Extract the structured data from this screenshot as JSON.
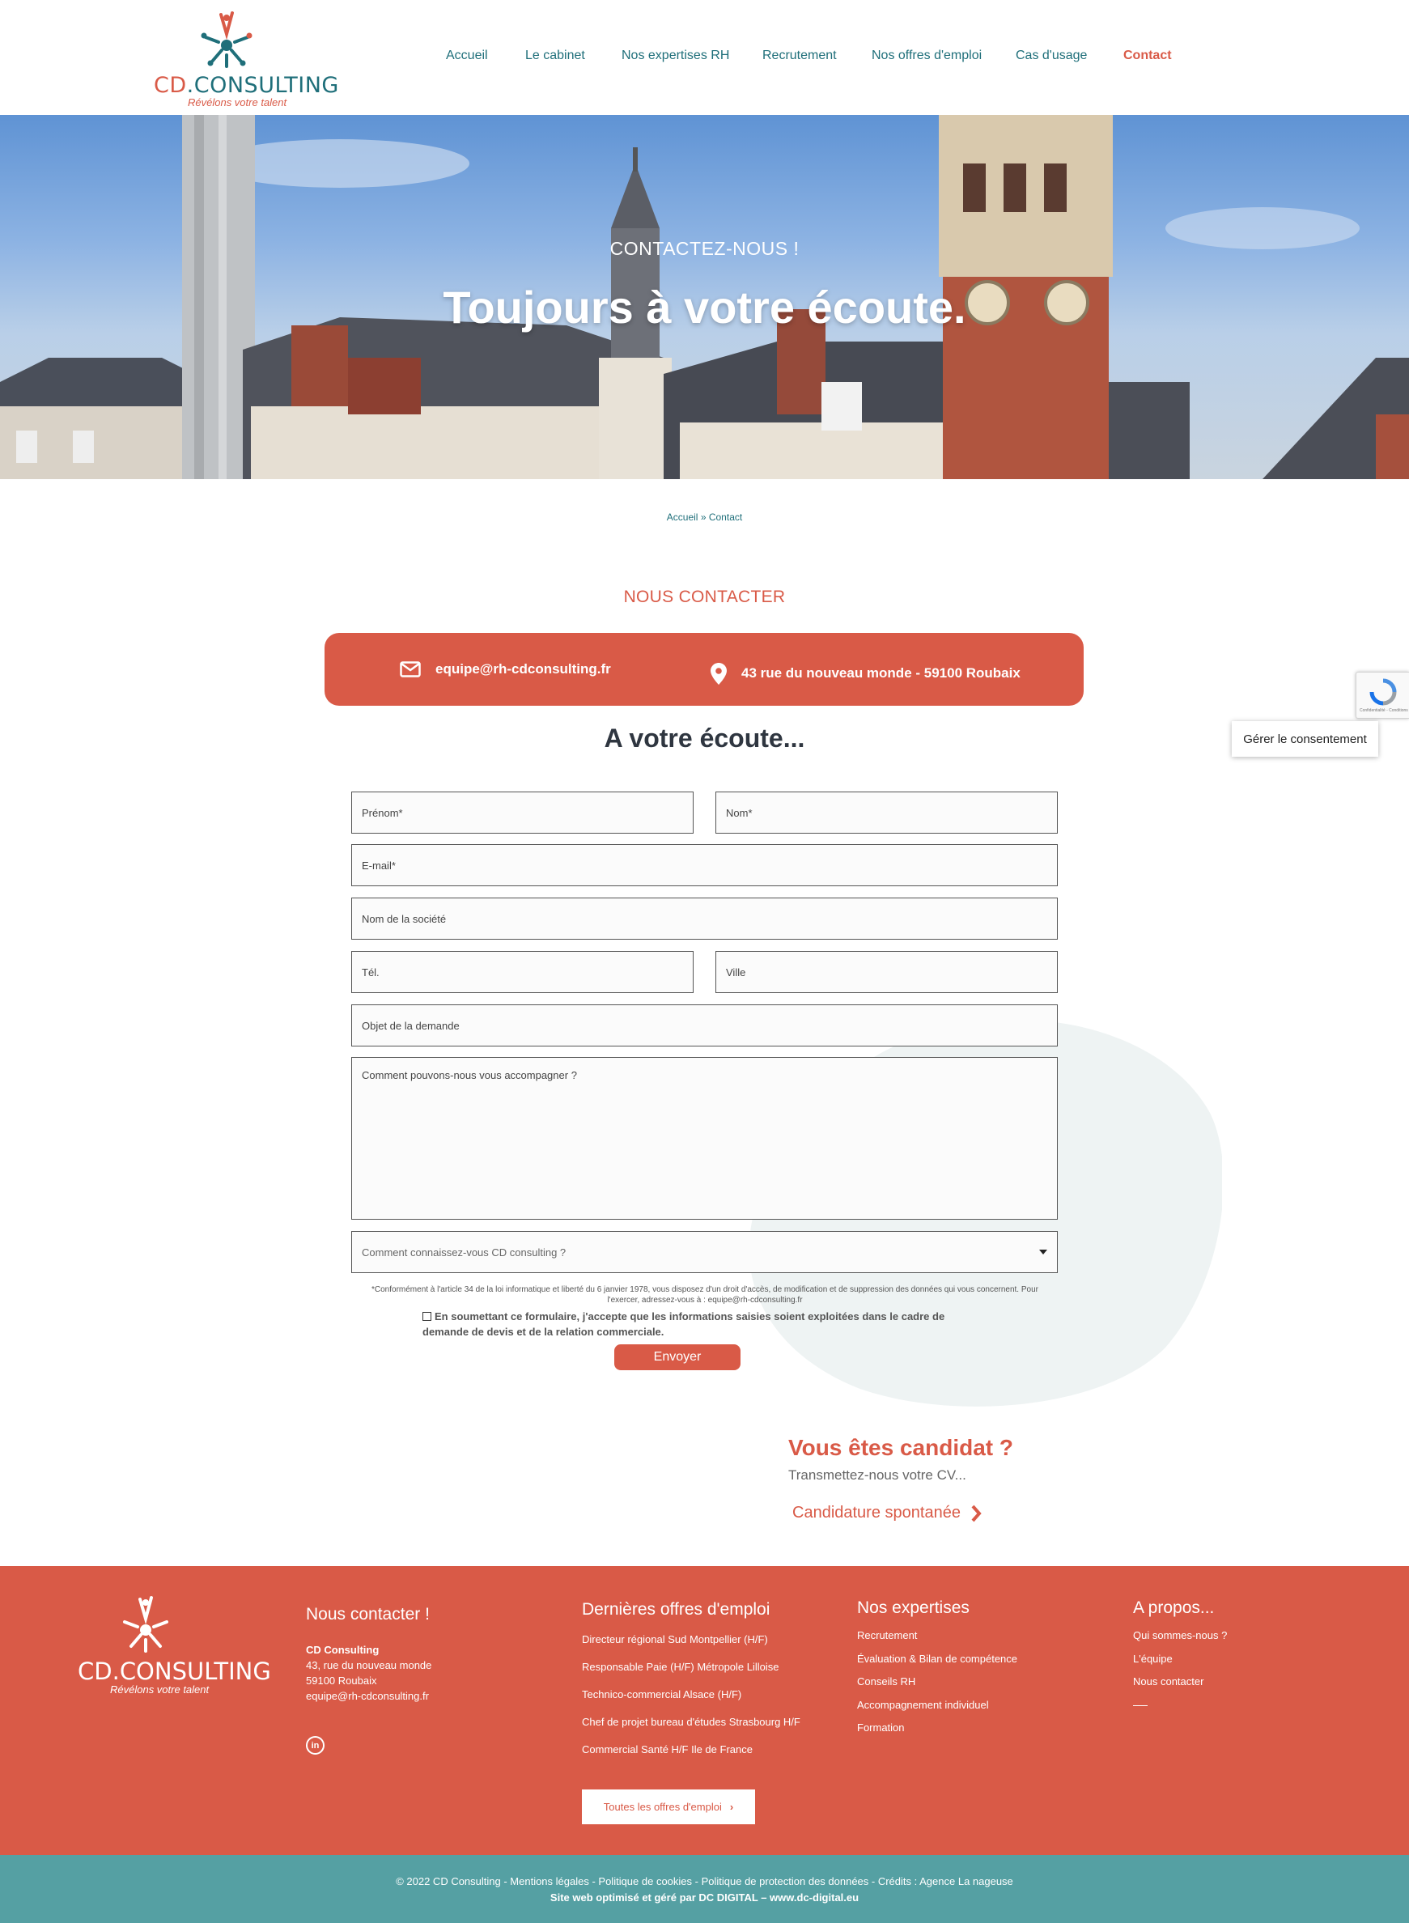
{
  "brand": {
    "logo_main": "CONSULTING",
    "logo_prefix": "CD",
    "logo_tagline": "Révélons votre talent",
    "accent_color": "#d95a47",
    "teal_color": "#1f6f7a"
  },
  "nav": {
    "items": [
      {
        "label": "Accueil"
      },
      {
        "label": "Le cabinet"
      },
      {
        "label": "Nos expertises RH"
      },
      {
        "label": "Recrutement"
      },
      {
        "label": "Nos offres d'emploi"
      },
      {
        "label": "Cas d'usage"
      },
      {
        "label": "Contact"
      }
    ],
    "active": "Contact"
  },
  "hero": {
    "kicker": "CONTACTEZ-NOUS !",
    "title": "Toujours à votre écoute."
  },
  "breadcrumb": {
    "home": "Accueil",
    "separator": "»",
    "current": "Contact"
  },
  "contact": {
    "section_title": "NOUS CONTACTER",
    "email": "equipe@rh-cdconsulting.fr",
    "address": "43 rue du nouveau monde - 59100 Roubaix"
  },
  "form": {
    "title": "A votre écoute...",
    "first_name": "Prénom*",
    "last_name": "Nom*",
    "email": "E-mail*",
    "company": "Nom de la société",
    "phone": "Tél.",
    "city": "Ville",
    "subject": "Objet de la demande",
    "message": "Comment pouvons-nous vous accompagner ?",
    "source_select": "Comment connaissez-vous CD consulting ?",
    "legal_line1": "*Conformément à l'article 34 de la loi informatique et liberté du 6 janvier 1978, vous disposez d'un droit d'accès, de modification et de suppression des données qui vous concernent. Pour",
    "legal_line2": "l'exercer, adressez-vous à : equipe@rh-cdconsulting.fr",
    "consent_text": "En soumettant ce formulaire, j'accepte que les informations saisies soient exploitées dans le cadre de demande de devis et de la relation commerciale.",
    "submit": "Envoyer"
  },
  "widgets": {
    "recaptcha_text": "Confidentialité - Conditions",
    "consent_manager": "Gérer le consentement"
  },
  "candidate": {
    "title": "Vous êtes candidat ?",
    "subtitle": "Transmettez-nous votre CV...",
    "link": "Candidature spontanée"
  },
  "footer": {
    "contact": {
      "heading": "Nous contacter !",
      "company": "CD Consulting",
      "street": "43, rue du nouveau monde",
      "city": "59100 Roubaix",
      "email": "equipe@rh-cdconsulting.fr"
    },
    "offers": {
      "heading": "Dernières offres d'emploi",
      "items": [
        "Directeur régional Sud Montpellier (H/F)",
        "Responsable Paie (H/F) Métropole Lilloise",
        "Technico-commercial Alsace (H/F)",
        "Chef de projet bureau d'études Strasbourg H/F",
        "Commercial Santé H/F Ile de France"
      ],
      "all_button": "Toutes les offres d'emploi"
    },
    "expertises": {
      "heading": "Nos expertises",
      "items": [
        "Recrutement",
        "Évaluation & Bilan de compétence",
        "Conseils RH",
        "Accompagnement individuel",
        "Formation"
      ]
    },
    "about": {
      "heading": "A propos...",
      "items": [
        "Qui sommes-nous ?",
        "L'équipe",
        "Nous contacter"
      ]
    },
    "social": {
      "linkedin": "in"
    }
  },
  "bottom_bar": {
    "line1": "© 2022 CD Consulting - Mentions légales - Politique de cookies - Politique de protection des données - Crédits : Agence  La nageuse",
    "line2": "Site web optimisé et géré par DC DIGITAL – www.dc-digital.eu"
  }
}
